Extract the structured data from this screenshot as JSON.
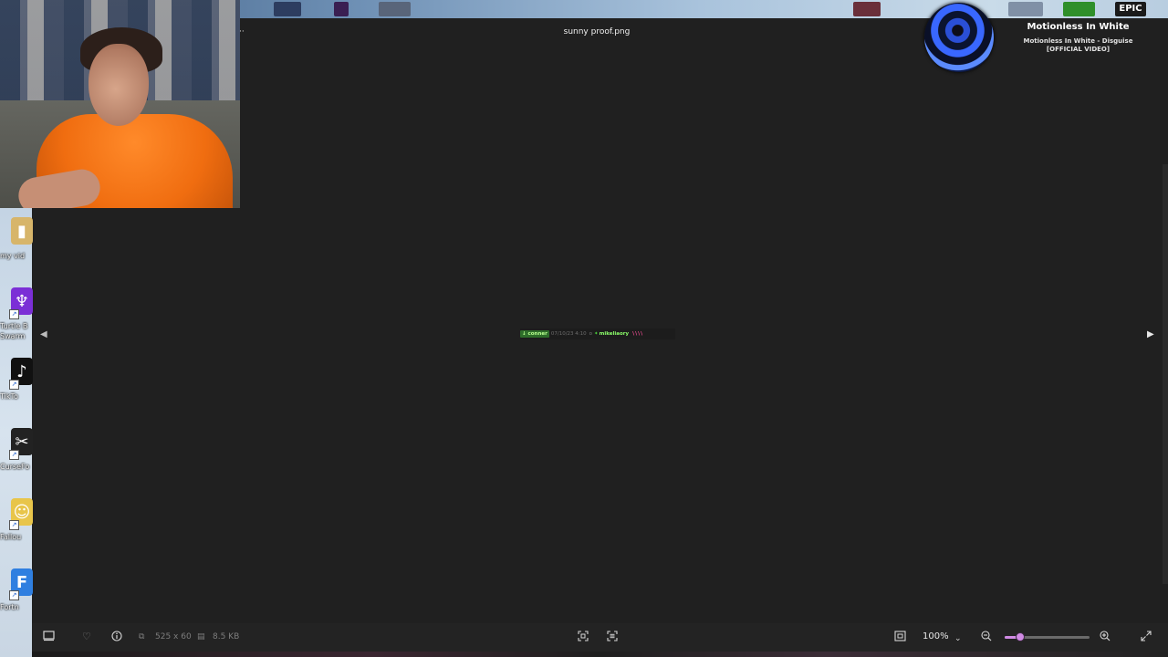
{
  "viewer": {
    "file_name": "sunny proof.png",
    "more_label": "··",
    "prev_label": "◀",
    "next_label": "▶",
    "dimensions": "525 x 60",
    "file_size": "8.5 KB",
    "zoom": "100%",
    "zoom_level": 0.18
  },
  "now_playing": {
    "artist": "Motionless In White",
    "song": "Motionless In White - Disguise [OFFICIAL VIDEO]"
  },
  "chat_image": {
    "badge": "↓ conner",
    "timestamp": "07/10/23 4:10",
    "separator": "o",
    "user": "mikeliaory",
    "message": "\\\\\\\\"
  },
  "taskbar": {
    "epic_label": "EPIC"
  },
  "desktop_icons": [
    {
      "label": "my vid",
      "icon": "folder-icon",
      "color": "#d7b56a"
    },
    {
      "label": "Turtle B Swarm",
      "icon": "turtle-beach-icon",
      "color": "#7b2fd6"
    },
    {
      "label": "TikTo",
      "icon": "tiktok-icon",
      "color": "#111111"
    },
    {
      "label": "CurseFo",
      "icon": "curseforge-icon",
      "color": "#222222"
    },
    {
      "label": "Fallou",
      "icon": "fallout-icon",
      "color": "#e8c54a"
    },
    {
      "label": "Fortn",
      "icon": "fortnite-icon",
      "color": "#2f7fe0"
    }
  ],
  "colors": {
    "accent": "#d08ae4",
    "background": "#202020",
    "toolbar": "#232323"
  }
}
